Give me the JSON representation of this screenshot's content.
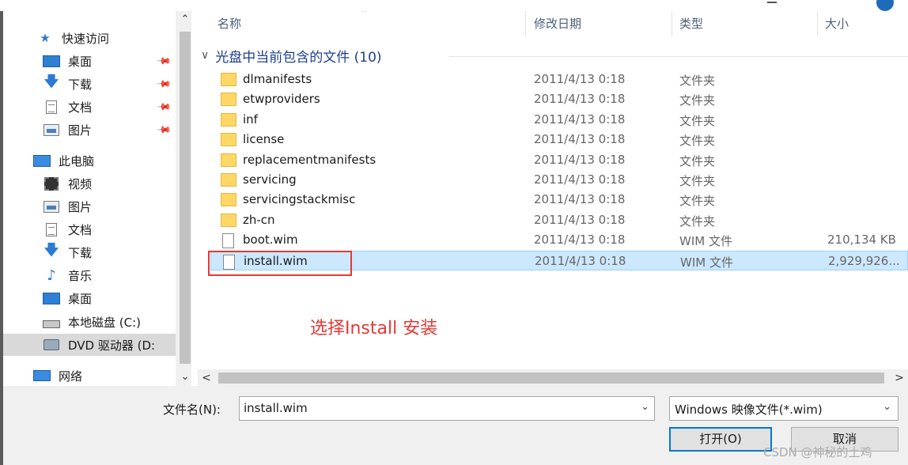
{
  "nav": {
    "quick_access": "快速访问",
    "pinned": [
      {
        "label": "桌面",
        "icon": "desktop-icon"
      },
      {
        "label": "下载",
        "icon": "download-icon"
      },
      {
        "label": "文档",
        "icon": "document-icon"
      },
      {
        "label": "图片",
        "icon": "pictures-icon"
      }
    ],
    "this_pc": "此电脑",
    "pc_items": [
      {
        "label": "视频",
        "icon": "video-icon"
      },
      {
        "label": "图片",
        "icon": "pictures-icon"
      },
      {
        "label": "文档",
        "icon": "document-icon"
      },
      {
        "label": "下载",
        "icon": "download-icon"
      },
      {
        "label": "音乐",
        "icon": "music-icon"
      },
      {
        "label": "桌面",
        "icon": "desktop-icon"
      },
      {
        "label": "本地磁盘 (C:)",
        "icon": "local-disk-icon"
      },
      {
        "label": "DVD 驱动器 (D:",
        "icon": "dvd-drive-icon"
      }
    ],
    "network": "网络"
  },
  "columns": {
    "name": "名称",
    "date": "修改日期",
    "type": "类型",
    "size": "大小"
  },
  "group_title": "光盘中当前包含的文件 (10)",
  "files": [
    {
      "name": "dlmanifests",
      "date": "2011/4/13 0:18",
      "type": "文件夹",
      "size": "",
      "kind": "folder"
    },
    {
      "name": "etwproviders",
      "date": "2011/4/13 0:18",
      "type": "文件夹",
      "size": "",
      "kind": "folder"
    },
    {
      "name": "inf",
      "date": "2011/4/13 0:18",
      "type": "文件夹",
      "size": "",
      "kind": "folder"
    },
    {
      "name": "license",
      "date": "2011/4/13 0:18",
      "type": "文件夹",
      "size": "",
      "kind": "folder"
    },
    {
      "name": "replacementmanifests",
      "date": "2011/4/13 0:18",
      "type": "文件夹",
      "size": "",
      "kind": "folder"
    },
    {
      "name": "servicing",
      "date": "2011/4/13 0:18",
      "type": "文件夹",
      "size": "",
      "kind": "folder"
    },
    {
      "name": "servicingstackmisc",
      "date": "2011/4/13 0:18",
      "type": "文件夹",
      "size": "",
      "kind": "folder"
    },
    {
      "name": "zh-cn",
      "date": "2011/4/13 0:18",
      "type": "文件夹",
      "size": "",
      "kind": "folder"
    },
    {
      "name": "boot.wim",
      "date": "2011/4/13 0:18",
      "type": "WIM 文件",
      "size": "210,134 KB",
      "kind": "file"
    },
    {
      "name": "install.wim",
      "date": "2011/4/13 0:18",
      "type": "WIM 文件",
      "size": "2,929,926...",
      "kind": "file",
      "selected": true
    }
  ],
  "annotation": "选择Install 安装",
  "filename_label": "文件名(N):",
  "filename_value": "install.wim",
  "filetype_value": "Windows 映像文件(*.wim)",
  "open_button": "打开(O)",
  "cancel_button": "取消",
  "watermark": "CSDN @神秘的土鸡",
  "colors": {
    "selection": "#cce8ff",
    "annotation": "#e53935",
    "group_title": "#1e3f8f"
  }
}
